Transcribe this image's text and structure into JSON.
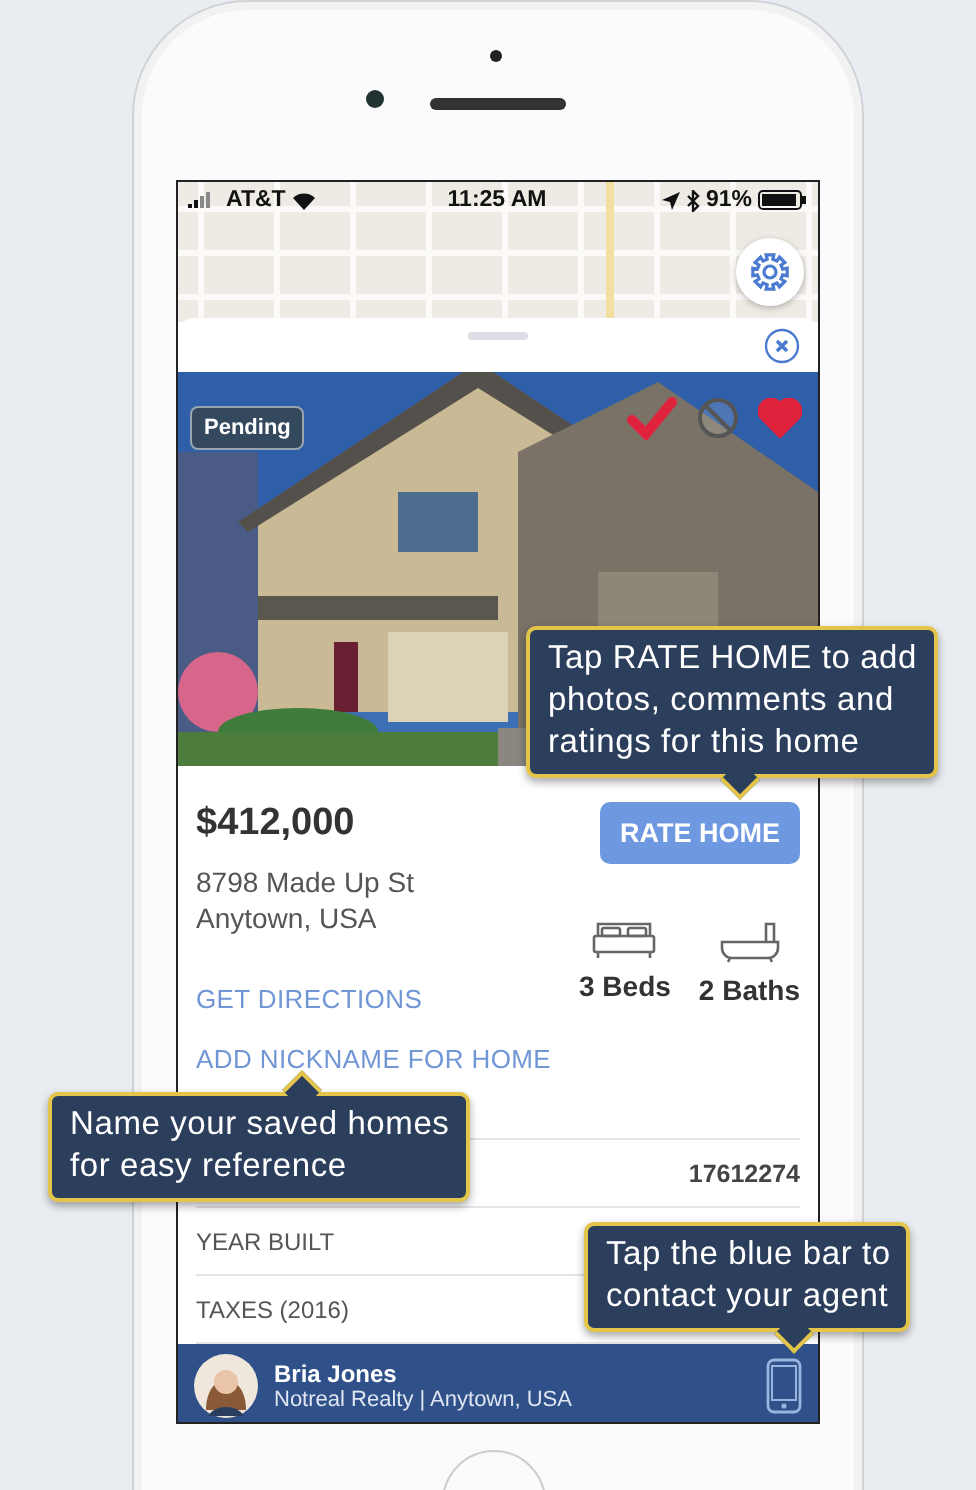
{
  "status_bar": {
    "carrier": "AT&T",
    "time": "11:25 AM",
    "battery": "91%"
  },
  "listing": {
    "status_badge": "Pending",
    "actions": [
      {
        "kind": "check",
        "on": true
      },
      {
        "kind": "block",
        "on": false
      },
      {
        "kind": "heart",
        "on": true
      }
    ],
    "price": "$412,000",
    "address_lines": [
      "8798 Made Up St",
      "Anytown, USA"
    ],
    "rate_button": "RATE HOME",
    "get_directions": "GET DIRECTIONS",
    "add_nickname": "ADD NICKNAME FOR HOME",
    "features": [
      {
        "kind": "bed",
        "label": "3 Beds"
      },
      {
        "kind": "bath",
        "label": "2 Baths"
      }
    ]
  },
  "facts": [
    {
      "value": "17612274"
    },
    {
      "label": "YEAR BUILT"
    },
    {
      "label": "TAXES (2016)"
    }
  ],
  "agent": {
    "name": "Bria Jones",
    "company": "Notreal Realty | Anytown, USA"
  },
  "tips": [
    {
      "lines": [
        "Tap RATE HOME to add",
        "photos, comments and",
        "ratings for this home"
      ],
      "pointer_below": true
    },
    {
      "lines": [
        "Name your saved homes",
        "for easy reference"
      ],
      "pointer_below": false
    },
    {
      "lines": [
        "Tap the blue bar to",
        "contact your agent"
      ],
      "pointer_below": true
    }
  ]
}
